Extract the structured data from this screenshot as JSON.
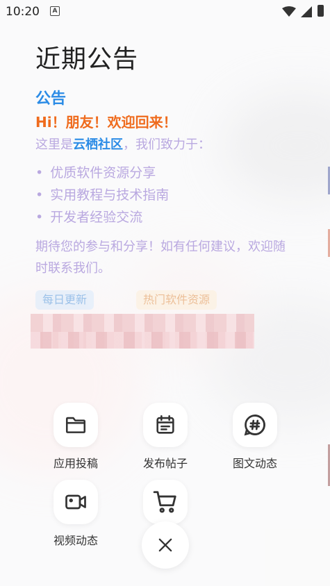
{
  "status_bar": {
    "time": "10:20",
    "notification_icon": "A"
  },
  "announcement": {
    "title": "近期公告",
    "section_title": "公告",
    "greeting": "Hi！朋友！欢迎回来！",
    "intro_prefix": "这里是",
    "brand": "云栖社区",
    "intro_suffix": "，我们致力于：",
    "features": [
      "优质软件资源分享",
      "实用教程与技术指南",
      "开发者经验交流"
    ],
    "closing": "期待您的参与和分享！如有任何建议，欢迎随时联系我们。",
    "tags": [
      "每日更新",
      "热门软件资源"
    ]
  },
  "actions": [
    {
      "label": "应用投稿",
      "icon": "folder-icon"
    },
    {
      "label": "发布帖子",
      "icon": "calendar-icon"
    },
    {
      "label": "图文动态",
      "icon": "hashtag-icon"
    },
    {
      "label": "视频动态",
      "icon": "video-icon"
    },
    {
      "label": "",
      "icon": "cart-icon"
    }
  ],
  "close_icon": "close-icon"
}
